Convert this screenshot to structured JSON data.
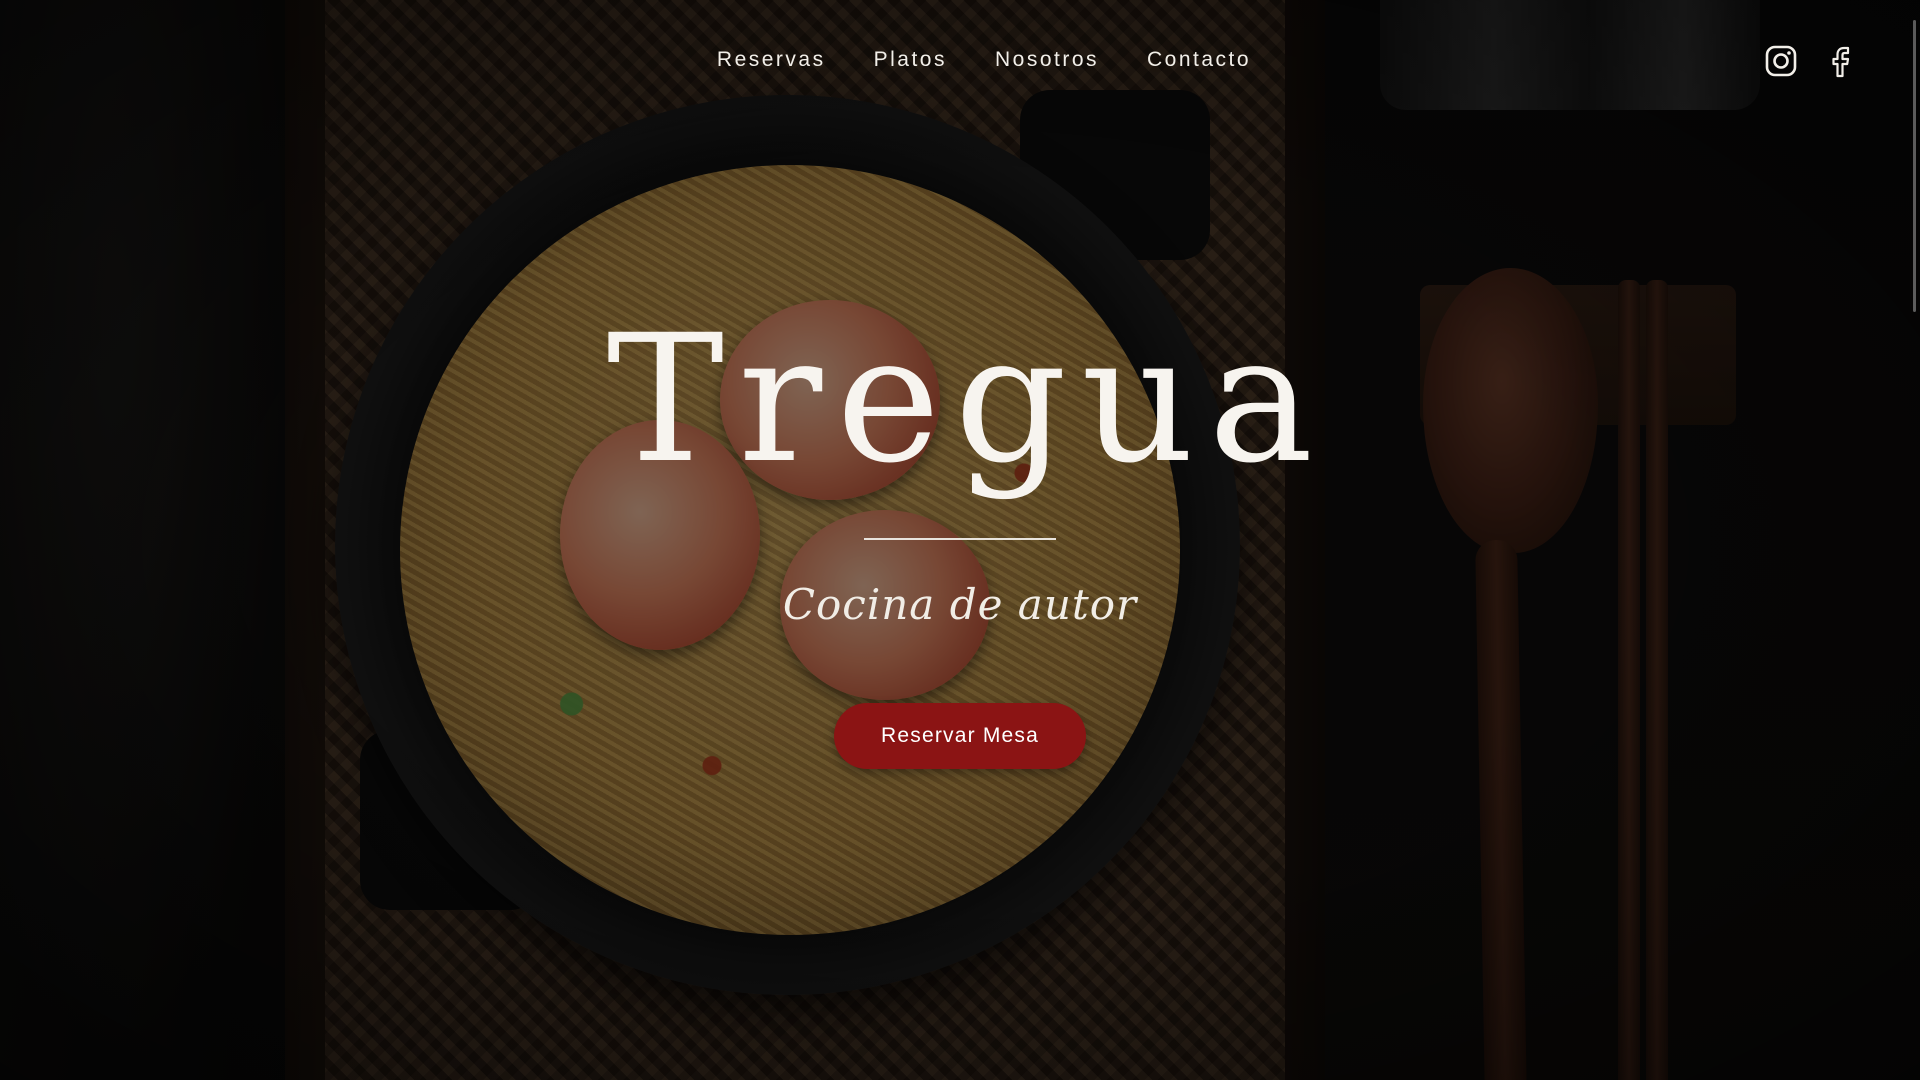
{
  "nav": {
    "items": [
      {
        "label": "Reservas"
      },
      {
        "label": "Platos"
      },
      {
        "label": "Nosotros"
      },
      {
        "label": "Contacto"
      }
    ]
  },
  "social": {
    "instagram_icon": "instagram-icon",
    "facebook_icon": "facebook-icon"
  },
  "hero": {
    "title": "Tregua",
    "subtitle": "Cocina de autor",
    "cta_label": "Reservar Mesa"
  },
  "colors": {
    "accent": "#8b1414",
    "text": "#f7f4ef",
    "overlay": "rgba(0,0,0,0.48)"
  }
}
